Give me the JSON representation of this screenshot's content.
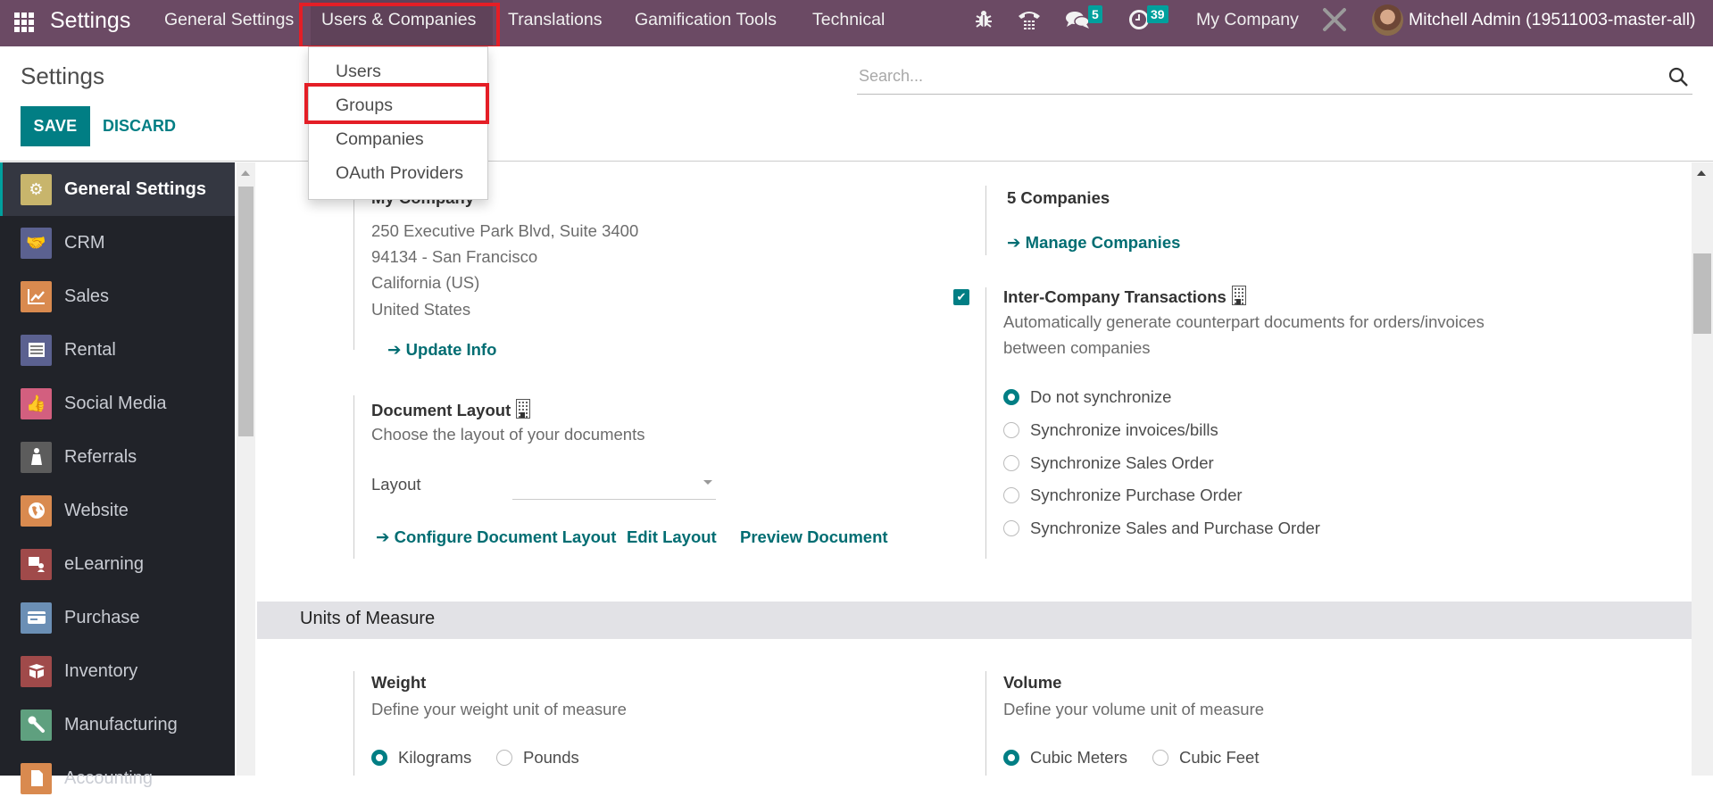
{
  "navbar": {
    "app_title": "Settings",
    "menus": [
      {
        "label": "General Settings"
      },
      {
        "label": "Users & Companies"
      },
      {
        "label": "Translations"
      },
      {
        "label": "Gamification Tools"
      },
      {
        "label": "Technical"
      }
    ],
    "active_menu": "Users & Companies",
    "messages_count": "5",
    "activities_count": "39",
    "company": "My Company",
    "user": "Mitchell Admin (19511003-master-all)"
  },
  "dropdown": {
    "items": [
      {
        "label": "Users"
      },
      {
        "label": "Groups"
      },
      {
        "label": "Companies"
      },
      {
        "label": "OAuth Providers"
      }
    ],
    "highlighted": "Groups"
  },
  "control_panel": {
    "title": "Settings",
    "save_label": "SAVE",
    "discard_label": "DISCARD",
    "search_placeholder": "Search..."
  },
  "sidebar": {
    "items": [
      {
        "label": "General Settings",
        "icon": "gear-icon",
        "color": "#c8b56c",
        "active": true
      },
      {
        "label": "CRM",
        "icon": "handshake-icon",
        "color": "#5b6190"
      },
      {
        "label": "Sales",
        "icon": "chart-up-icon",
        "color": "#d98a4f"
      },
      {
        "label": "Rental",
        "icon": "calendar-icon",
        "color": "#5b6190"
      },
      {
        "label": "Social Media",
        "icon": "thumbs-up-icon",
        "color": "#d35f7f"
      },
      {
        "label": "Referrals",
        "icon": "person-icon",
        "color": "#5c5c5c"
      },
      {
        "label": "Website",
        "icon": "globe-icon",
        "color": "#d98a4f"
      },
      {
        "label": "eLearning",
        "icon": "presentation-icon",
        "color": "#a04a4a"
      },
      {
        "label": "Purchase",
        "icon": "credit-card-icon",
        "color": "#6b8fb5"
      },
      {
        "label": "Inventory",
        "icon": "box-icon",
        "color": "#a04a4a"
      },
      {
        "label": "Manufacturing",
        "icon": "wrench-icon",
        "color": "#5fa07f"
      },
      {
        "label": "Accounting",
        "icon": "document-icon",
        "color": "#d98a4f"
      }
    ]
  },
  "companies": {
    "company_title": "My Company",
    "address_lines": [
      "250 Executive Park Blvd, Suite 3400",
      "94134 - San Francisco",
      "California (US)",
      "United States"
    ],
    "update_info_label": "Update Info",
    "companies_count_label": "5 Companies",
    "manage_companies_label": "Manage Companies"
  },
  "document_layout": {
    "title": "Document Layout",
    "description": "Choose the layout of your documents",
    "layout_label": "Layout",
    "layout_value": "",
    "configure_label": "Configure Document Layout",
    "edit_label": "Edit Layout",
    "preview_label": "Preview Document"
  },
  "inter_company": {
    "checked": true,
    "title": "Inter-Company Transactions",
    "description_line1": "Automatically generate counterpart documents for orders/invoices",
    "description_line2": "between companies",
    "options": [
      {
        "label": "Do not synchronize",
        "checked": true
      },
      {
        "label": "Synchronize invoices/bills",
        "checked": false
      },
      {
        "label": "Synchronize Sales Order",
        "checked": false
      },
      {
        "label": "Synchronize Purchase Order",
        "checked": false
      },
      {
        "label": "Synchronize Sales and Purchase Order",
        "checked": false
      }
    ]
  },
  "units_of_measure": {
    "section_title": "Units of Measure",
    "weight": {
      "title": "Weight",
      "description": "Define your weight unit of measure",
      "options": [
        {
          "label": "Kilograms",
          "checked": true
        },
        {
          "label": "Pounds",
          "checked": false
        }
      ]
    },
    "volume": {
      "title": "Volume",
      "description": "Define your volume unit of measure",
      "options": [
        {
          "label": "Cubic Meters",
          "checked": true
        },
        {
          "label": "Cubic Feet",
          "checked": false
        }
      ]
    }
  },
  "colors": {
    "navbar": "#6b4a64",
    "primary": "#017e84",
    "badge": "#00a09d",
    "sidebar": "#212329",
    "highlight": "#e41e26"
  }
}
